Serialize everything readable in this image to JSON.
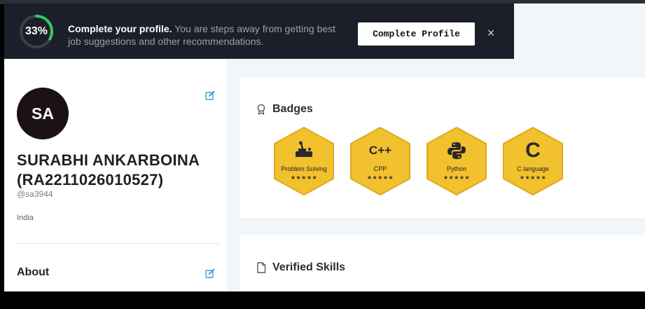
{
  "banner": {
    "progress_label": "33%",
    "progress_fraction": 0.33,
    "title": "Complete your profile.",
    "message": "You are steps away from getting best job suggestions and other recommendations.",
    "button_label": "Complete Profile",
    "close_glyph": "×"
  },
  "profile": {
    "initials": "SA",
    "name": "SURABHI ANKARBOINA (RA2211026010527)",
    "handle": "@sa3944",
    "country": "India",
    "about_title": "About"
  },
  "badges": {
    "title": "Badges",
    "items": [
      {
        "glyph": "",
        "label": "Problem Solving",
        "stars": "★★★★★",
        "icon": "problem-solving-icon"
      },
      {
        "glyph": "C++",
        "label": "CPP",
        "stars": "★★★★★",
        "icon": "cpp-icon"
      },
      {
        "glyph": "",
        "label": "Python",
        "stars": "★★★★★",
        "icon": "python-icon"
      },
      {
        "glyph": "C",
        "label": "C language",
        "stars": "★★★★★",
        "icon": "c-language-icon"
      }
    ]
  },
  "skills": {
    "title": "Verified Skills"
  },
  "colors": {
    "banner_bg": "#1b1f29",
    "progress_green": "#2ec866",
    "badge_gold": "#f2c12e",
    "badge_gold_dark": "#e0a81c",
    "edit_blue": "#39a1d4"
  }
}
